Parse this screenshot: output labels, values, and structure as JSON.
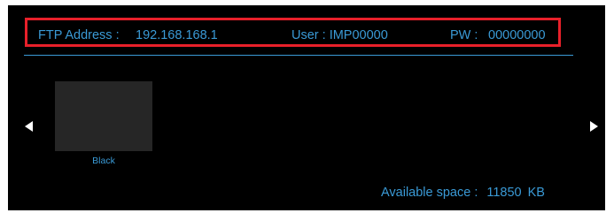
{
  "ftp": {
    "address_label": "FTP Address :",
    "address_value": "192.168.168.1",
    "user_label": "User : IMP00000",
    "pw_label": "PW :",
    "pw_value": "00000000"
  },
  "gallery": {
    "items": [
      {
        "label": "Black",
        "swatch_color": "#262626"
      }
    ],
    "prev_icon": "triangle-left-icon",
    "next_icon": "triangle-right-icon"
  },
  "storage": {
    "label": "Available space :",
    "value": "11850",
    "unit": "KB"
  },
  "colors": {
    "background": "#000000",
    "highlight_border": "#e8202a",
    "text_accent": "#3a9ad6"
  }
}
